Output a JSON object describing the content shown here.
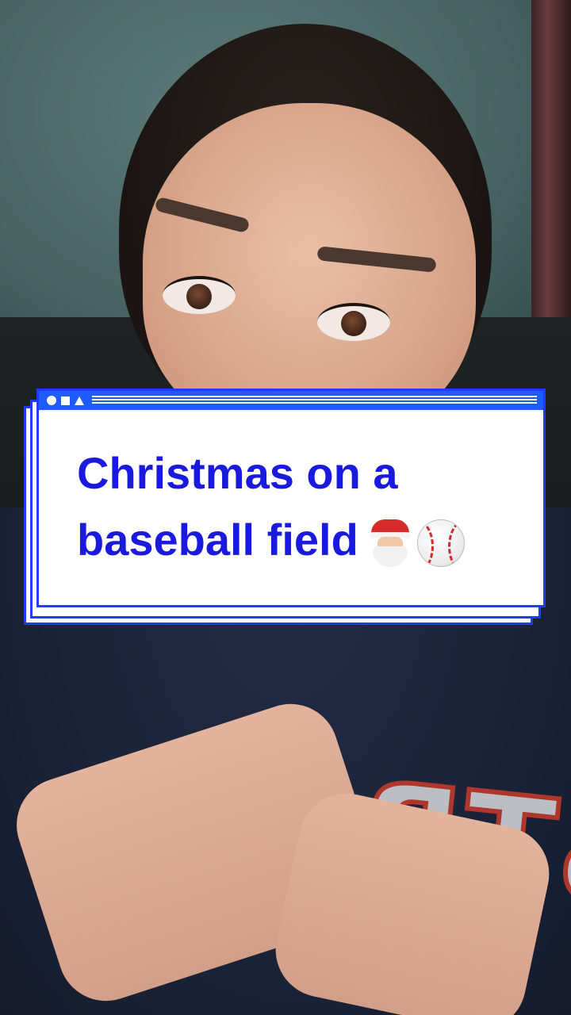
{
  "caption": {
    "line1": "Christmas on a",
    "line2": "baseball field"
  },
  "emojis": [
    "santa-claus-icon",
    "baseball-icon"
  ],
  "colors": {
    "caption_text": "#1a1adf",
    "card_border": "#1f3bff",
    "titlebar": "#1f5cff",
    "card_bg": "#ffffff"
  }
}
